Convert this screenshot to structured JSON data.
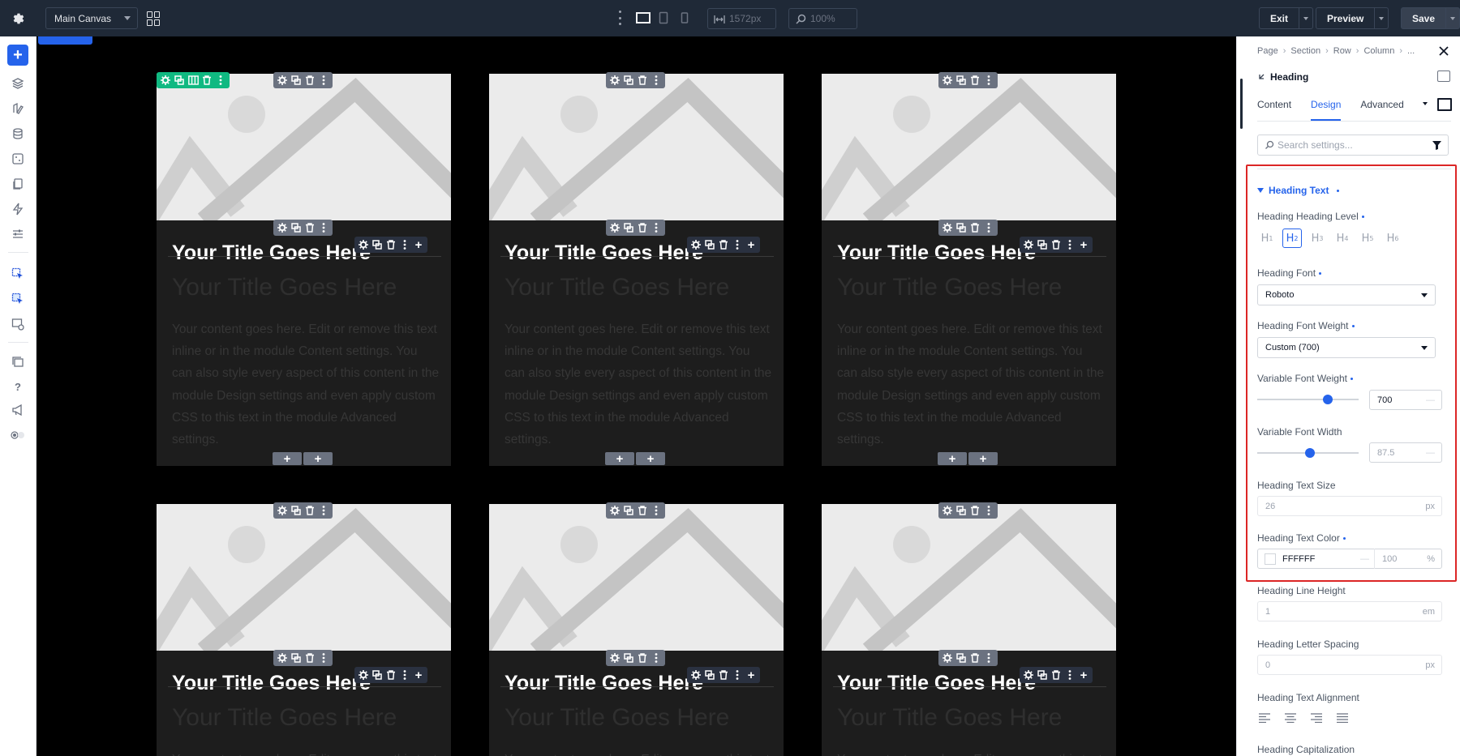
{
  "topbar": {
    "canvas_label": "Main Canvas",
    "width_value": "1572px",
    "zoom_value": "100%",
    "exit_label": "Exit",
    "preview_label": "Preview",
    "save_label": "Save"
  },
  "cards": [
    {
      "title": "Your Title Goes Here",
      "subtitle": "Your Title Goes Here",
      "body": "Your content goes here. Edit or remove this text inline or in the module Content settings. You can also style every aspect of this content in the module Design settings and even apply custom CSS to this text in the module Advanced settings."
    },
    {
      "title": "Your Title Goes Here",
      "subtitle": "Your Title Goes Here",
      "body": "Your content goes here. Edit or remove this text inline or in the module Content settings. You can also style every aspect of this content in the module Design settings and even apply custom CSS to this text in the module Advanced settings."
    },
    {
      "title": "Your Title Goes Here",
      "subtitle": "Your Title Goes Here",
      "body": "Your content goes here. Edit or remove this text inline or in the module Content settings. You can also style every aspect of this content in the module Design settings and even apply custom CSS to this text in the module Advanced settings."
    },
    {
      "title": "Your Title Goes Here",
      "subtitle": "Your Title Goes Here",
      "body": "Your content goes here. Edit or remove this text inline or in the module Content settings."
    },
    {
      "title": "Your Title Goes Here",
      "subtitle": "Your Title Goes Here",
      "body": "Your content goes here. Edit or remove this text inline or in the module Content settings."
    },
    {
      "title": "Your Title Goes Here",
      "subtitle": "Your Title Goes Here",
      "body": "Your content goes here. Edit or remove this text inline or in the module Content settings."
    }
  ],
  "panel": {
    "breadcrumb": [
      "Page",
      "Section",
      "Row",
      "Column",
      "..."
    ],
    "element_name": "Heading",
    "tabs": [
      "Content",
      "Design",
      "Advanced"
    ],
    "active_tab": "Design",
    "search_placeholder": "Search settings...",
    "group_title": "Heading Text",
    "fields": {
      "heading_level_label": "Heading Heading Level",
      "heading_levels": [
        "H",
        "H",
        "H",
        "H",
        "H",
        "H"
      ],
      "heading_level_nums": [
        "1",
        "2",
        "3",
        "4",
        "5",
        "6"
      ],
      "heading_level_active": 2,
      "font_label": "Heading Font",
      "font_value": "Roboto",
      "weight_label": "Heading Font Weight",
      "weight_value": "Custom (700)",
      "var_weight_label": "Variable Font Weight",
      "var_weight_value": "700",
      "var_weight_fraction": 0.72,
      "var_width_label": "Variable Font Width",
      "var_width_value": "87.5",
      "var_width_fraction": 0.52,
      "text_size_label": "Heading Text Size",
      "text_size_value": "26",
      "text_size_unit": "px",
      "text_color_label": "Heading Text Color",
      "text_color_value": "FFFFFF",
      "text_color_alpha": "100",
      "text_color_pct": "%",
      "line_height_label": "Heading Line Height",
      "line_height_value": "1",
      "line_height_unit": "em",
      "letter_spacing_label": "Heading Letter Spacing",
      "letter_spacing_value": "0",
      "letter_spacing_unit": "px",
      "alignment_label": "Heading Text Alignment",
      "capitalization_label": "Heading Capitalization"
    }
  },
  "colors": {
    "accent": "#2563eb",
    "topbar": "#1f2937",
    "highlight": "#dc2626",
    "module_toolbar": "#6b7280",
    "row_toolbar": "#10b981"
  }
}
